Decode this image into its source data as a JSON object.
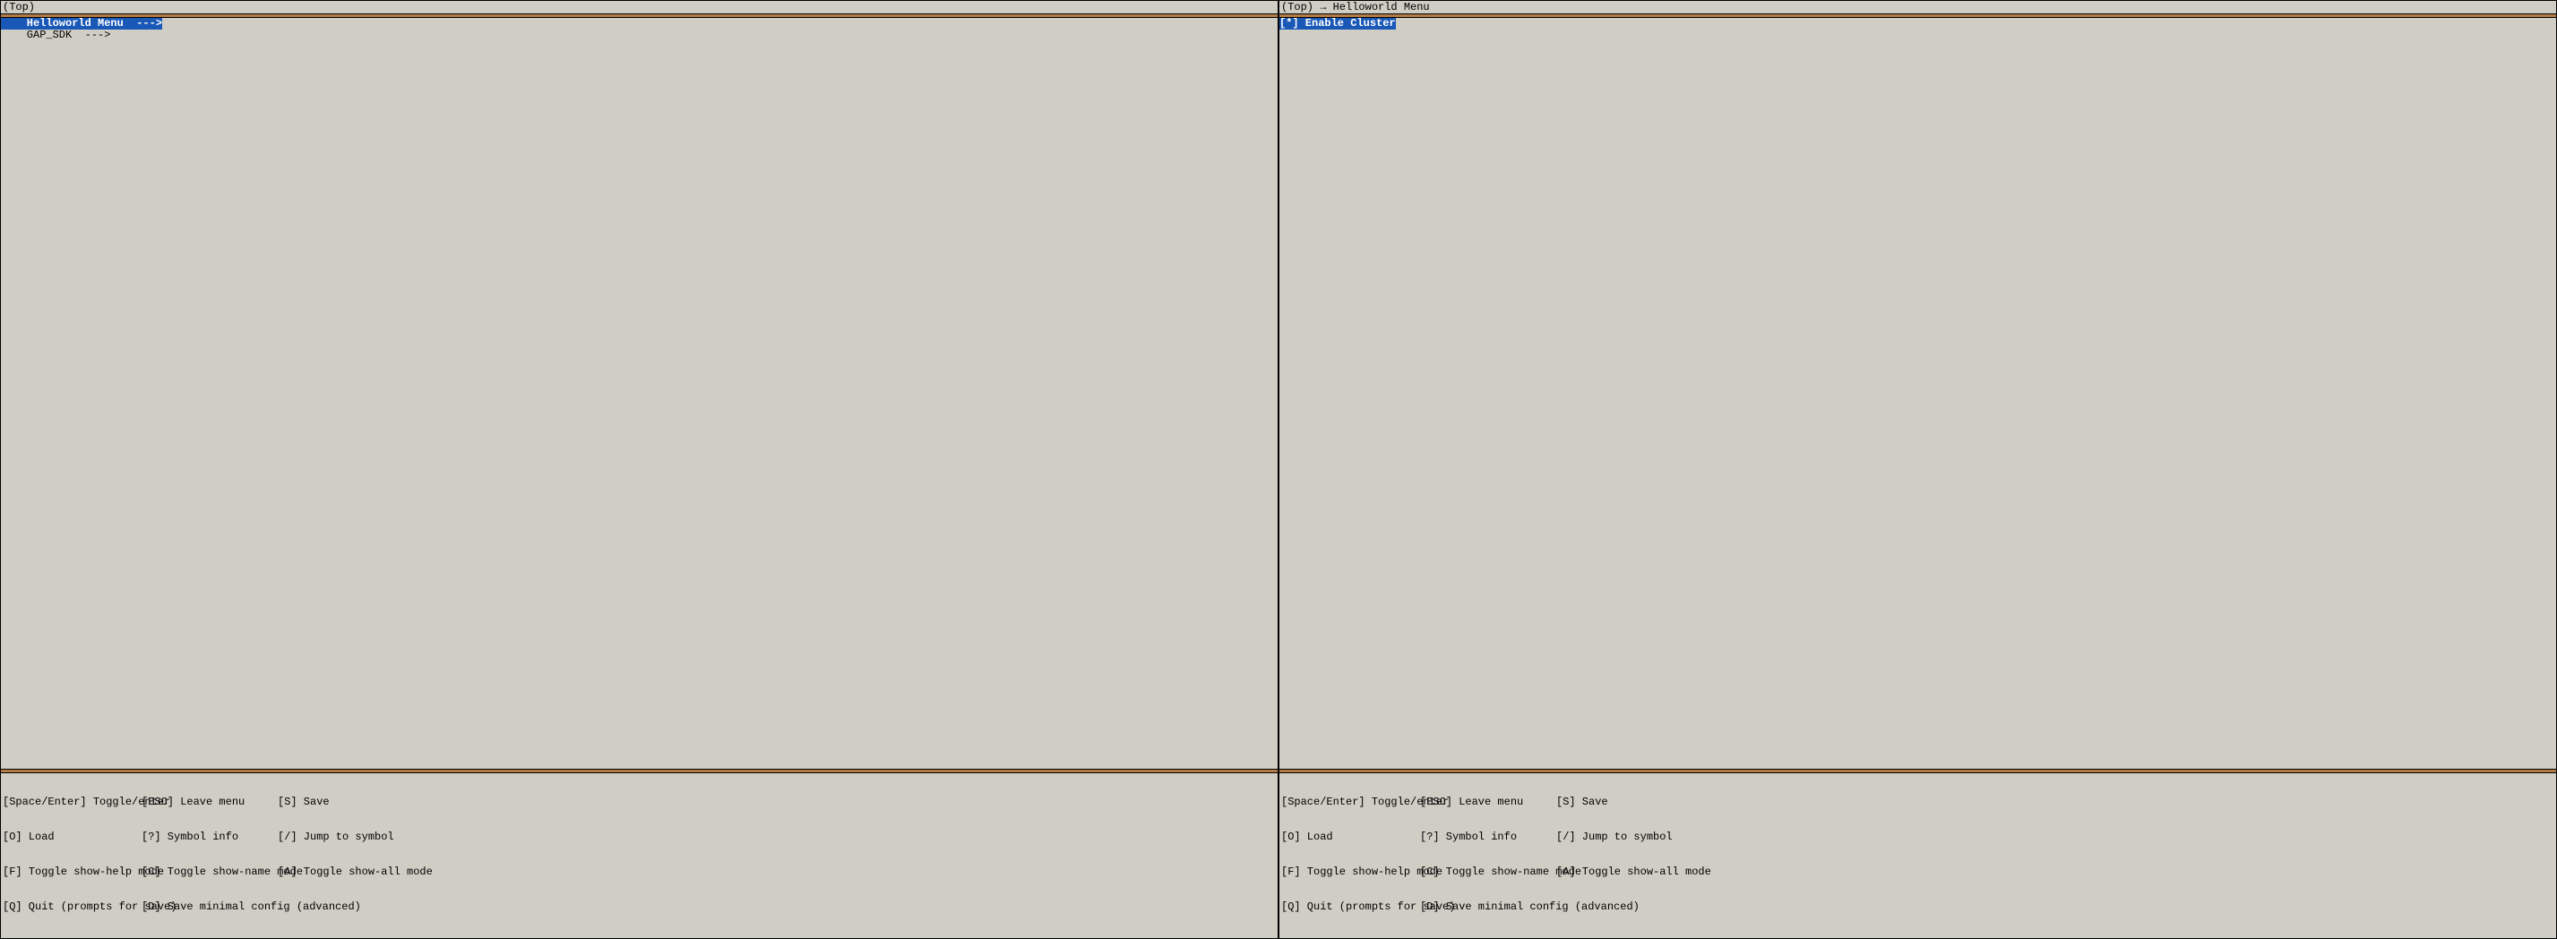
{
  "left": {
    "breadcrumb": "(Top)",
    "menu": [
      {
        "label": "    Helloworld Menu  --->",
        "selected": true
      },
      {
        "label": "    GAP_SDK  --->",
        "selected": false
      }
    ]
  },
  "right": {
    "breadcrumb": "(Top) → Helloworld Menu",
    "menu": [
      {
        "label": "[*] Enable Cluster",
        "selected": true
      }
    ]
  },
  "help": {
    "rows": [
      {
        "c1": "[Space/Enter] Toggle/enter",
        "c2": "[ESC] Leave menu",
        "c3": "[S] Save"
      },
      {
        "c1": "[O] Load",
        "c2": "[?] Symbol info",
        "c3": "[/] Jump to symbol"
      },
      {
        "c1": "[F] Toggle show-help mode",
        "c2": "[C] Toggle show-name mode",
        "c3": "[A] Toggle show-all mode"
      },
      {
        "c1": "[Q] Quit (prompts for save)",
        "c2": "[D] Save minimal config (advanced)",
        "c3": ""
      }
    ]
  }
}
